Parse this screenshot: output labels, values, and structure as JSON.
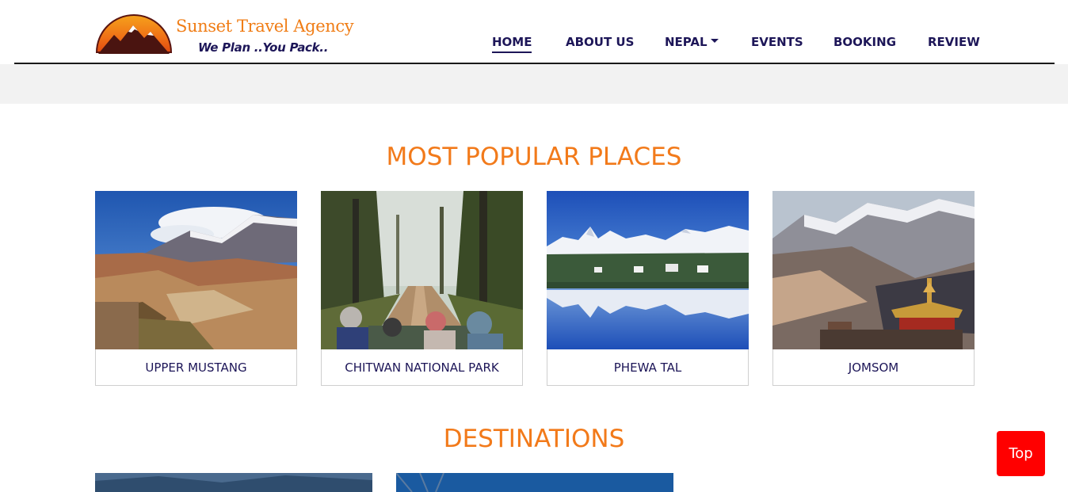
{
  "brand": {
    "name": "Sunset Travel Agency",
    "tagline": "We Plan ..You Pack..",
    "colors": {
      "orange": "#f07d16",
      "navy": "#1d1658"
    }
  },
  "nav": {
    "items": [
      {
        "label": "HOME",
        "active": true
      },
      {
        "label": "ABOUT US",
        "active": false
      },
      {
        "label": "NEPAL",
        "active": false,
        "dropdown": true
      },
      {
        "label": "EVENTS",
        "active": false
      },
      {
        "label": "BOOKING",
        "active": false
      },
      {
        "label": "REVIEW",
        "active": false
      }
    ]
  },
  "popular": {
    "title": "MOST POPULAR PLACES",
    "places": [
      {
        "label": "UPPER MUSTANG",
        "image": "mustang-canyon-photo"
      },
      {
        "label": "CHITWAN NATIONAL PARK",
        "image": "jungle-safari-jeep-photo"
      },
      {
        "label": "PHEWA TAL",
        "image": "lake-reflection-photo"
      },
      {
        "label": "JOMSOM",
        "image": "mountain-temple-photo"
      }
    ]
  },
  "destinations": {
    "title": "DESTINATIONS"
  },
  "top_button": {
    "label": "Top",
    "color": "#ff0000"
  }
}
